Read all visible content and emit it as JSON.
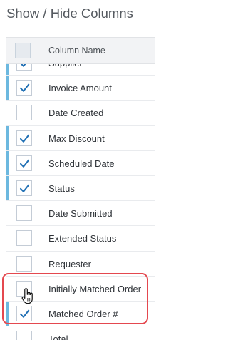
{
  "panel": {
    "title": "Show / Hide Columns",
    "header_label": "Column Name"
  },
  "colors": {
    "accent": "#6cb8df",
    "check": "#1f6fb4",
    "highlight": "#e4484f"
  },
  "columns": [
    {
      "label": "Supplier",
      "checked": true
    },
    {
      "label": "Invoice Amount",
      "checked": true
    },
    {
      "label": "Date Created",
      "checked": false
    },
    {
      "label": "Max Discount",
      "checked": true
    },
    {
      "label": "Scheduled Date",
      "checked": true
    },
    {
      "label": "Status",
      "checked": true
    },
    {
      "label": "Date Submitted",
      "checked": false
    },
    {
      "label": "Extended Status",
      "checked": false
    },
    {
      "label": "Requester",
      "checked": false
    },
    {
      "label": "Initially Matched Order",
      "checked": false
    },
    {
      "label": "Matched Order #",
      "checked": true
    },
    {
      "label": "Total",
      "checked": false
    }
  ],
  "icons": {
    "checkmark": "checkmark-icon",
    "cursor": "hand-pointer-icon"
  }
}
